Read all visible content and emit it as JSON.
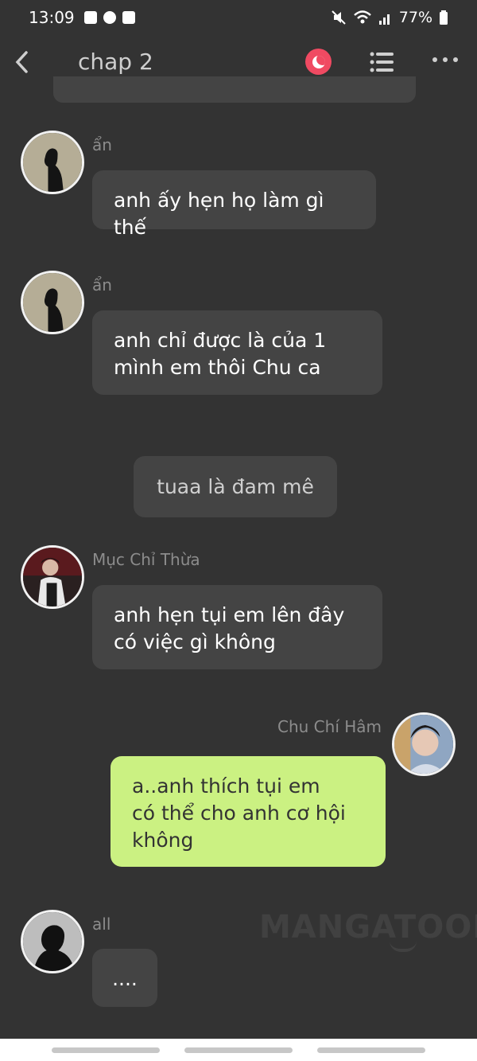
{
  "status_bar": {
    "time": "13:09",
    "battery": "77%"
  },
  "app_bar": {
    "title": "chap 2"
  },
  "messages": [
    {
      "sender": "ẩn",
      "text": "anh ấy hẹn họ làm gì thế"
    },
    {
      "sender": "ẩn",
      "text": "anh chỉ được là của 1\nmình em thôi Chu ca"
    },
    {
      "text": "tuaa là đam mê"
    },
    {
      "sender": "Mục Chỉ Thừa",
      "text": "anh hẹn tụi em lên đây\ncó việc gì không"
    },
    {
      "sender": "Chu Chí Hâm",
      "text": "a..anh thích tụi em\ncó thể cho anh cơ hội\nkhông"
    },
    {
      "sender": "all",
      "text": "...."
    }
  ],
  "watermark": "MANGATOON",
  "colors": {
    "background": "#333333",
    "bubble": "#444444",
    "my_bubble": "#cbf182",
    "accent": "#f04a62"
  }
}
